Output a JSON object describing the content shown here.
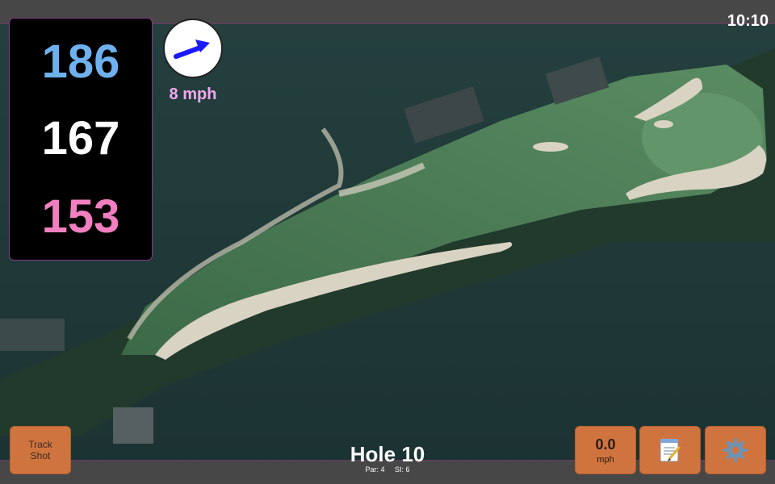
{
  "status": {
    "time": "10:10"
  },
  "distances": {
    "back": "186",
    "middle": "167",
    "front": "153"
  },
  "wind": {
    "speed": "8 mph",
    "arrow_icon": "wind-arrow-icon",
    "arrow_color": "#1a1aff"
  },
  "buttons": {
    "track_line1": "Track",
    "track_line2": "Shot",
    "speed_value": "0.0",
    "speed_unit": "mph",
    "notes_icon": "notepad-icon",
    "settings_icon": "gear-icon"
  },
  "hole": {
    "title": "Hole 10",
    "par": "Par: 4",
    "si": "SI: 6"
  },
  "colors": {
    "back_distance": "#6fb1ee",
    "middle_distance": "#ffffff",
    "front_distance": "#f17fc0",
    "button": "#d0743f",
    "bar": "#474747"
  }
}
